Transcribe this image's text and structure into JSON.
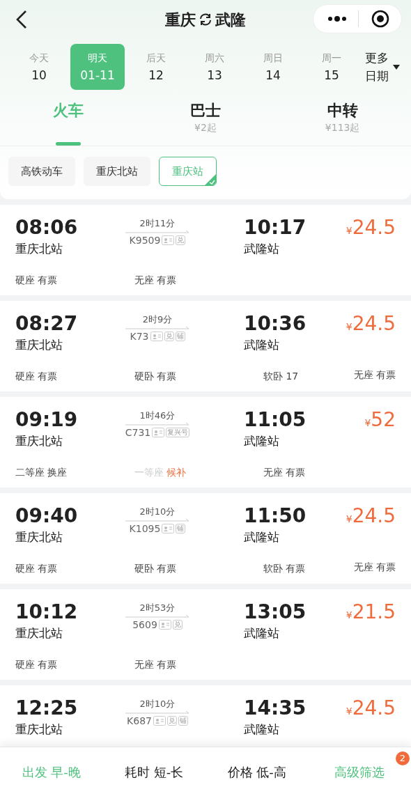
{
  "header": {
    "from": "重庆",
    "to": "武隆"
  },
  "dates": [
    {
      "weekday": "今天",
      "day": "10",
      "selected": false
    },
    {
      "weekday": "明天",
      "day": "01-11",
      "selected": true
    },
    {
      "weekday": "后天",
      "day": "12",
      "selected": false
    },
    {
      "weekday": "周六",
      "day": "13",
      "selected": false
    },
    {
      "weekday": "周日",
      "day": "14",
      "selected": false
    },
    {
      "weekday": "周一",
      "day": "15",
      "selected": false
    }
  ],
  "more_dates": {
    "line1": "更多",
    "line2": "日期"
  },
  "modes": [
    {
      "label": "火车",
      "selected": true
    },
    {
      "label": "巴士",
      "sub": "¥2起",
      "selected": false
    },
    {
      "label": "中转",
      "sub": "¥113起",
      "selected": false
    }
  ],
  "filters": [
    {
      "label": "高铁动车",
      "selected": false
    },
    {
      "label": "重庆北站",
      "selected": false
    },
    {
      "label": "重庆站",
      "selected": true
    }
  ],
  "trains": [
    {
      "depart": "08:06",
      "from": "重庆北站",
      "duration": "2时11分",
      "number": "K9509",
      "tags": [
        {
          "kind": "id"
        },
        {
          "kind": "text",
          "label": "兑"
        }
      ],
      "arrive": "10:17",
      "to": "武隆站",
      "currency": "¥",
      "price": "24.5",
      "seats": [
        {
          "name": "硬座",
          "status": "有票",
          "kind": "available"
        },
        {
          "name": "无座",
          "status": "有票",
          "kind": "available"
        }
      ]
    },
    {
      "depart": "08:27",
      "from": "重庆北站",
      "duration": "2时9分",
      "number": "K73",
      "tags": [
        {
          "kind": "id"
        },
        {
          "kind": "text",
          "label": "兑"
        },
        {
          "kind": "text",
          "label": "铺"
        }
      ],
      "arrive": "10:36",
      "to": "武隆站",
      "currency": "¥",
      "price": "24.5",
      "seats": [
        {
          "name": "硬座",
          "status": "有票",
          "kind": "available"
        },
        {
          "name": "硬卧",
          "status": "有票",
          "kind": "available"
        },
        {
          "name": "软卧",
          "status": "17",
          "kind": "available"
        },
        {
          "name": "无座",
          "status": "有票",
          "kind": "available"
        }
      ]
    },
    {
      "depart": "09:19",
      "from": "重庆北站",
      "duration": "1时46分",
      "number": "C731",
      "tags": [
        {
          "kind": "id"
        },
        {
          "kind": "text",
          "label": "复兴号"
        }
      ],
      "arrive": "11:05",
      "to": "武隆站",
      "currency": "¥",
      "price": "52",
      "seats": [
        {
          "name": "二等座",
          "status": "换座",
          "kind": "available"
        },
        {
          "name": "一等座",
          "status": "候补",
          "kind": "waitlist"
        },
        {
          "name": "无座",
          "status": "有票",
          "kind": "available"
        }
      ]
    },
    {
      "depart": "09:40",
      "from": "重庆北站",
      "duration": "2时10分",
      "number": "K1095",
      "tags": [
        {
          "kind": "id"
        },
        {
          "kind": "text",
          "label": "铺"
        }
      ],
      "arrive": "11:50",
      "to": "武隆站",
      "currency": "¥",
      "price": "24.5",
      "seats": [
        {
          "name": "硬座",
          "status": "有票",
          "kind": "available"
        },
        {
          "name": "硬卧",
          "status": "有票",
          "kind": "available"
        },
        {
          "name": "软卧",
          "status": "有票",
          "kind": "available"
        },
        {
          "name": "无座",
          "status": "有票",
          "kind": "available"
        }
      ]
    },
    {
      "depart": "10:12",
      "from": "重庆北站",
      "duration": "2时53分",
      "number": "5609",
      "tags": [
        {
          "kind": "id"
        },
        {
          "kind": "text",
          "label": "兑"
        }
      ],
      "arrive": "13:05",
      "to": "武隆站",
      "currency": "¥",
      "price": "21.5",
      "seats": [
        {
          "name": "硬座",
          "status": "有票",
          "kind": "available"
        },
        {
          "name": "无座",
          "status": "有票",
          "kind": "available"
        }
      ]
    },
    {
      "depart": "12:25",
      "from": "重庆北站",
      "duration": "2时10分",
      "number": "K687",
      "tags": [
        {
          "kind": "id"
        },
        {
          "kind": "text",
          "label": "兑"
        },
        {
          "kind": "text",
          "label": "铺"
        }
      ],
      "arrive": "14:35",
      "to": "武隆站",
      "currency": "¥",
      "price": "24.5"
    }
  ],
  "sort_bar": [
    {
      "label": "出发 早-晚",
      "selected": true
    },
    {
      "label": "耗时 短-长",
      "selected": false
    },
    {
      "label": "价格 低-高",
      "selected": false
    },
    {
      "label": "高级筛选",
      "selected": true,
      "badge": "2"
    }
  ]
}
